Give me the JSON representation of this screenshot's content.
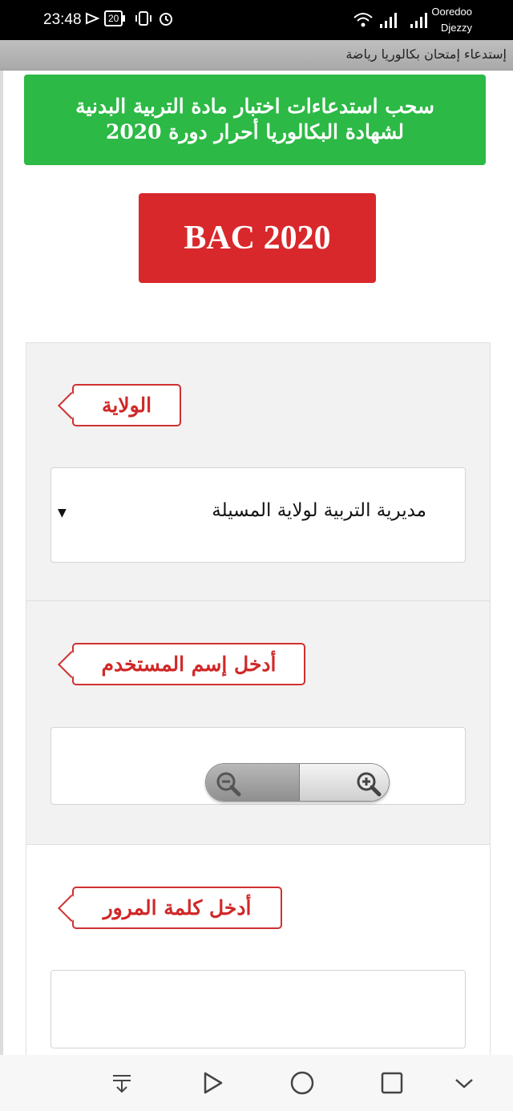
{
  "status_bar": {
    "time": "23:48",
    "battery": "20",
    "carrier_primary": "Ooredoo",
    "carrier_secondary": "Djezzy"
  },
  "title_bar": {
    "title": "إستدعاء إمتحان بكالوريا رياضة"
  },
  "banner": {
    "line1": "سحب استدعاءات اختبار مادة التربية البدنية",
    "line2": "لشهادة البكالوريا أحرار دورة 2020",
    "color": "#2cb945"
  },
  "bac_button": {
    "label": "BAC 2020",
    "color": "#d9282b"
  },
  "form": {
    "wilaya": {
      "label": "الولاية",
      "selected": "مديرية التربية لولاية المسيلة"
    },
    "username": {
      "label": "أدخل إسم المستخدم",
      "value": ""
    },
    "password": {
      "label": "أدخل كلمة المرور",
      "value": ""
    }
  },
  "icons": {
    "zoom_out": "zoom-out-icon",
    "zoom_in": "zoom-in-icon",
    "nav": [
      "download-icon",
      "back-triangle-icon",
      "home-circle-icon",
      "recents-square-icon",
      "collapse-chevron-icon"
    ]
  }
}
